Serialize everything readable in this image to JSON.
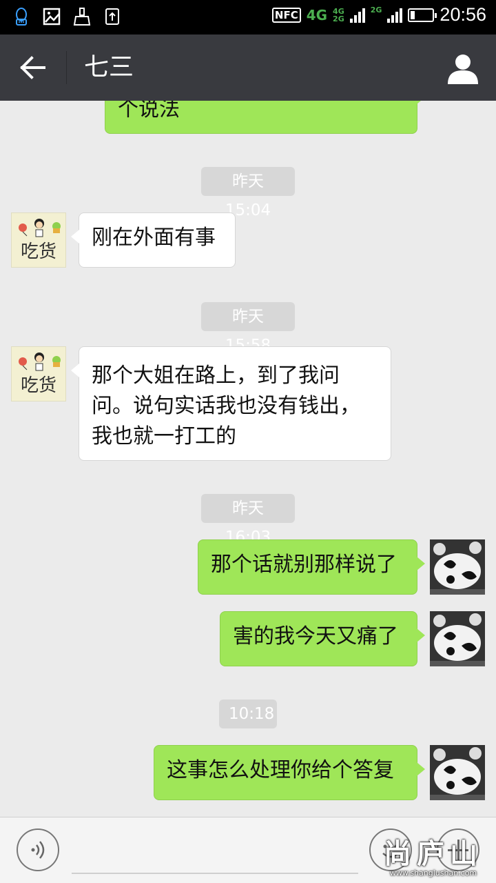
{
  "status_bar": {
    "nfc": "NFC",
    "net_main": "4G",
    "net_a_top": "4G",
    "net_a_bottom": "2G",
    "net_b": "2G",
    "battery_level": 0.2,
    "time": "20:56",
    "left_icons": [
      "qq-icon",
      "image-icon",
      "cleaner-icon",
      "upload-icon"
    ]
  },
  "header": {
    "title": "七三",
    "back_icon": "back-arrow-icon",
    "profile_icon": "person-icon"
  },
  "messages": {
    "prev_partial": "个说法",
    "ts1": "昨天 15:04",
    "in1": "刚在外面有事",
    "ts2": "昨天 15:58",
    "in2": "那个大姐在路上，到了我问问。说句实话我也没有钱出，我也就一打工的",
    "ts3": "昨天 16:03",
    "out1": "那个话就别那样说了",
    "out2": "害的我今天又痛了",
    "ts4": "10:18",
    "out3": "这事怎么处理你给个答复"
  },
  "contact_avatar_text": "吃货",
  "input_bar": {
    "placeholder": "",
    "voice_icon": "voice-icon",
    "emoji_icon": "emoji-icon",
    "plus_icon": "plus-icon"
  },
  "watermark": {
    "text": "尚庐山",
    "site": "www.shanglushan.com"
  }
}
